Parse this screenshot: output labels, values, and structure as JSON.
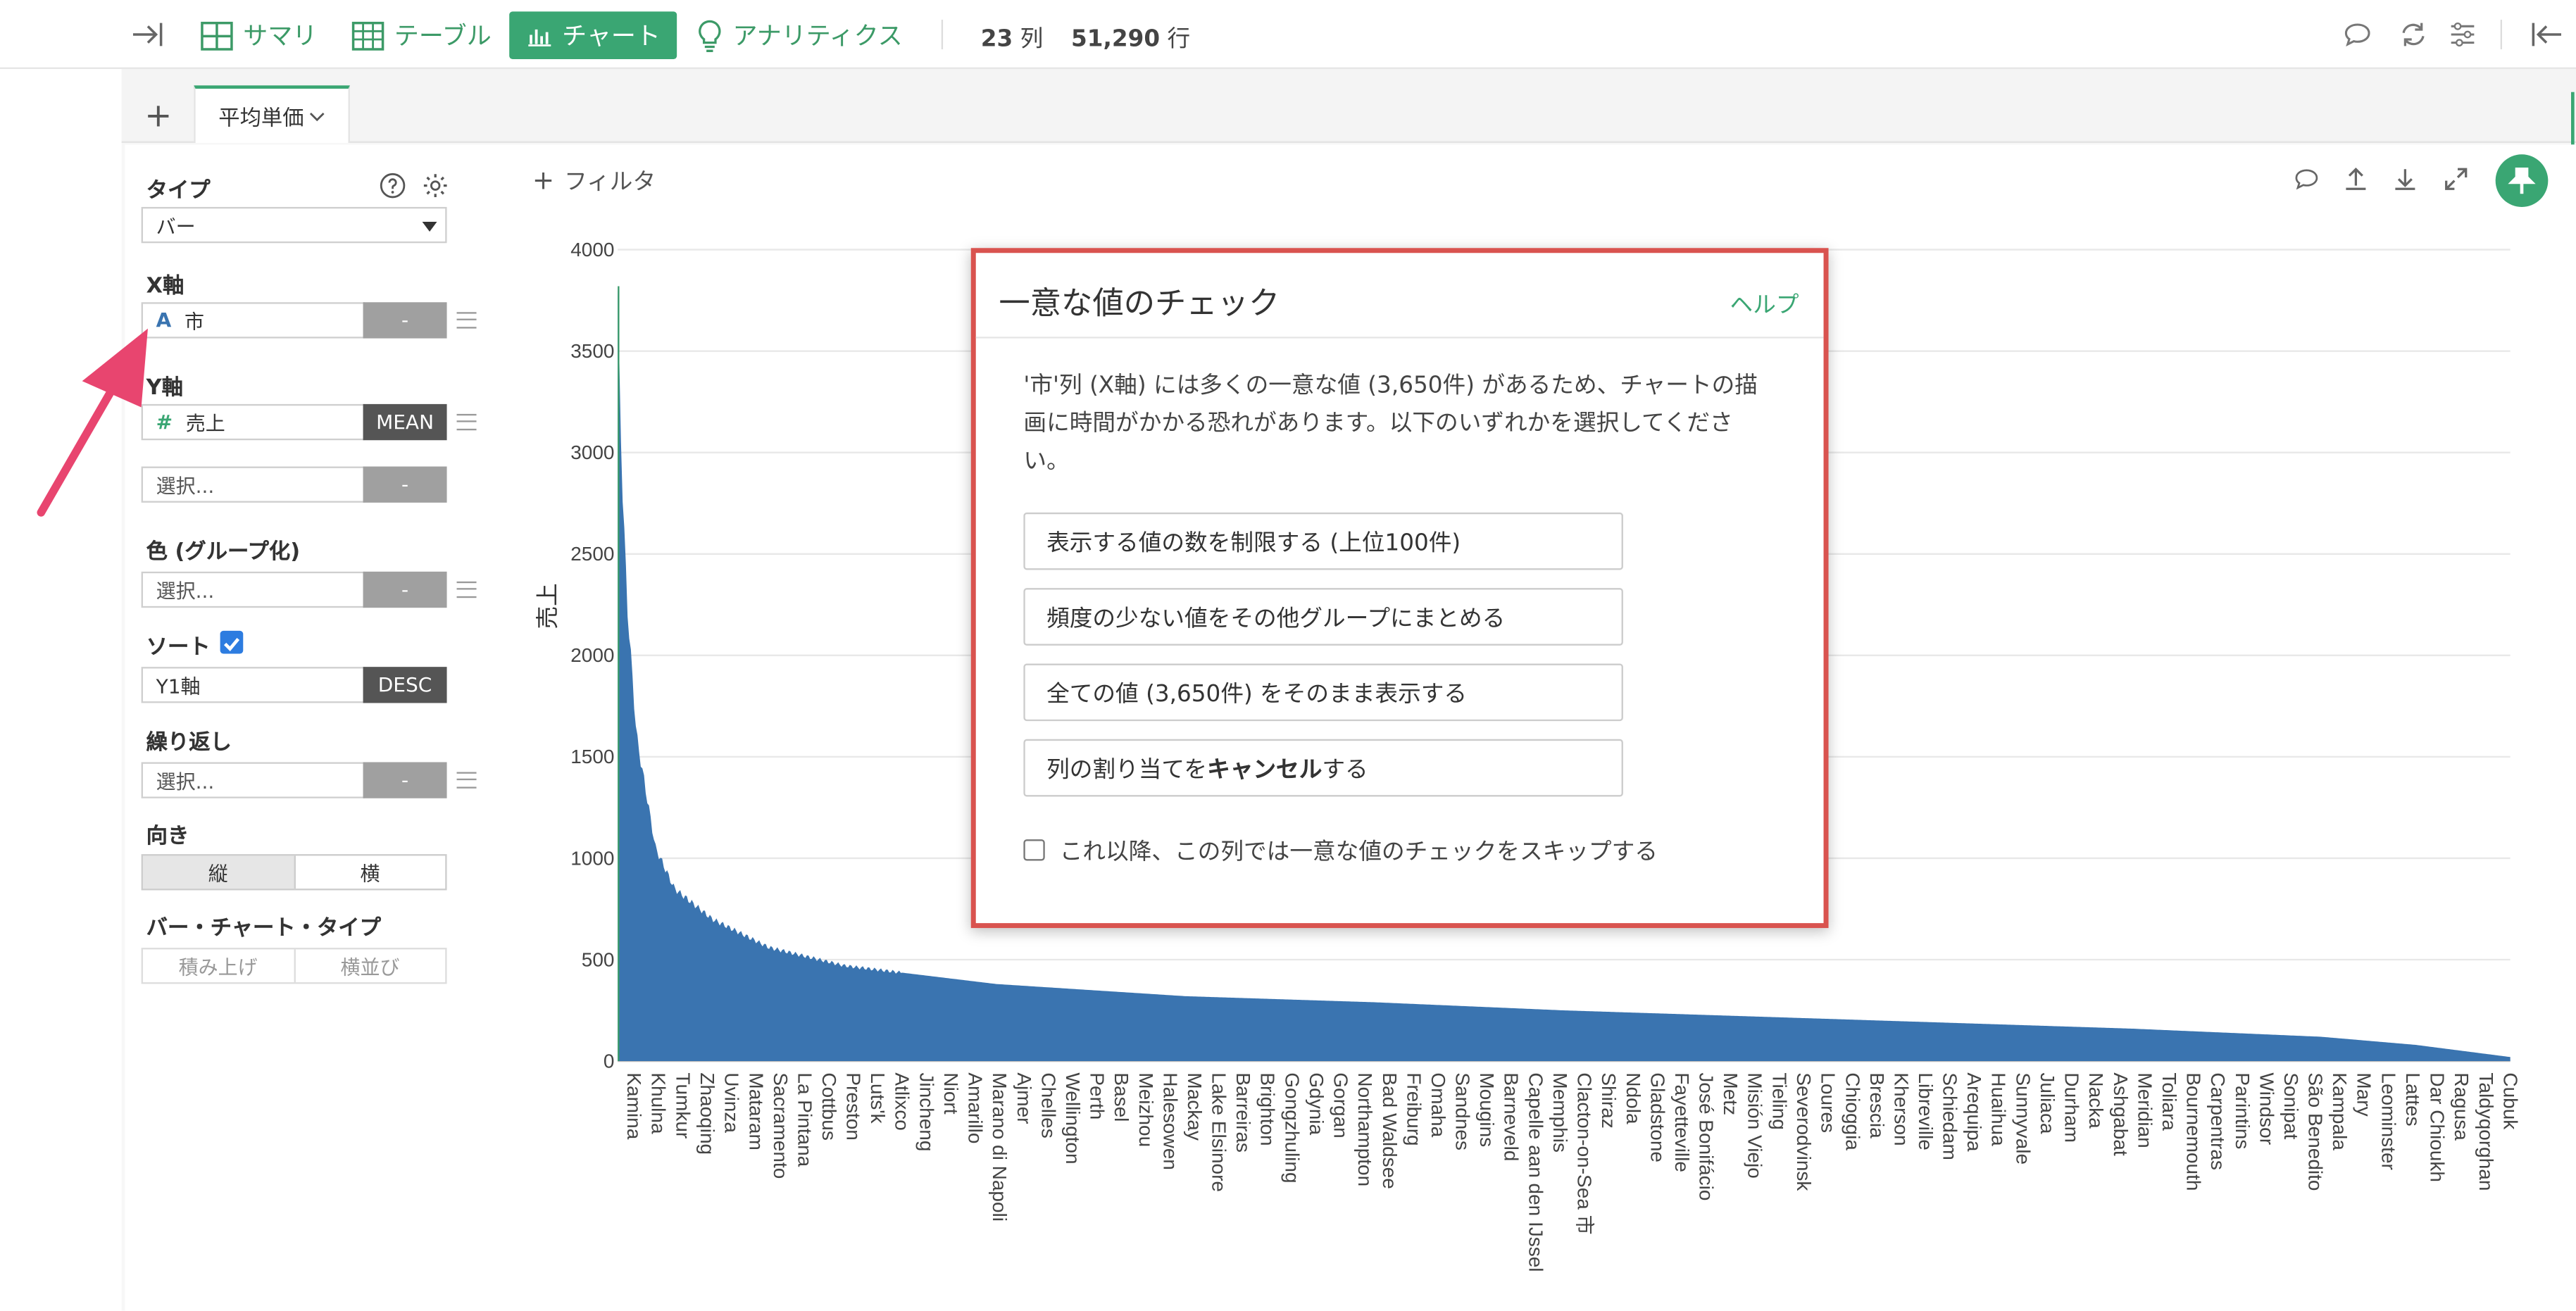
{
  "toolbar": {
    "tabs": [
      {
        "label": "サマリ",
        "icon": "summary-grid-icon"
      },
      {
        "label": "テーブル",
        "icon": "table-grid-icon"
      },
      {
        "label": "チャート",
        "icon": "bar-chart-icon",
        "active": true
      },
      {
        "label": "アナリティクス",
        "icon": "lightbulb-icon"
      }
    ],
    "columns_count": "23",
    "columns_unit": "列",
    "rows_count": "51,290",
    "rows_unit": "行",
    "accent_color": "#3aa673"
  },
  "chart_tabs": {
    "add_label": "+",
    "active_tab": "平均単価"
  },
  "left_panel": {
    "type_label": "タイプ",
    "type_value": "バー",
    "x_axis_label": "X軸",
    "x_column": "市",
    "x_agg": "-",
    "y_axis_label": "Y軸",
    "y_column": "売上",
    "y_agg": "MEAN",
    "y2_placeholder": "選択...",
    "y2_agg": "-",
    "color_label": "色 (グループ化)",
    "color_placeholder": "選択...",
    "color_agg": "-",
    "sort_label": "ソート",
    "sort_checked": true,
    "sort_by": "Y1軸",
    "sort_dir": "DESC",
    "repeat_label": "繰り返し",
    "repeat_placeholder": "選択...",
    "repeat_agg": "-",
    "orientation_label": "向き",
    "orientation_options": [
      "縦",
      "横"
    ],
    "bar_type_label": "バー・チャート・タイプ",
    "bar_type_options": [
      "積み上げ",
      "横並び"
    ]
  },
  "chart_header": {
    "filter_label": "フィルタ"
  },
  "modal": {
    "title": "一意な値のチェック",
    "help_link": "ヘルプ",
    "message_line1": "'市'列 (X軸) には多くの一意な値 (3,650件) があるため、チャートの描",
    "message_line2": "画に時間がかかる恐れがあります。以下のいずれかを選択してくださ",
    "message_line3": "い。",
    "option1": "表示する値の数を制限する (上位100件)",
    "option2": "頻度の少ない値をその他グループにまとめる",
    "option3": "全ての値 (3,650件) をそのまま表示する",
    "option4_prefix": "列の割り当てを",
    "option4_bold": "キャンセル",
    "option4_suffix": "する",
    "skip_label": "これ以降、この列では一意な値のチェックをスキップする"
  },
  "chart_data": {
    "type": "bar",
    "ylabel": "売上",
    "ylim": [
      0,
      4000
    ],
    "yticks": [
      0,
      500,
      1000,
      1500,
      2000,
      2500,
      3000,
      3500,
      4000
    ],
    "bar_color": "#3a74b0",
    "grid": true,
    "sorted": "descending",
    "series_profile": {
      "x_rank_pct": [
        0,
        0.2,
        0.5,
        1,
        2,
        3,
        5,
        8,
        12,
        20,
        30,
        40,
        50,
        60,
        70,
        80,
        90,
        95,
        100
      ],
      "y_value": [
        3820,
        2950,
        2250,
        1600,
        1050,
        850,
        700,
        560,
        470,
        380,
        320,
        290,
        250,
        220,
        190,
        160,
        120,
        80,
        20
      ]
    },
    "x_tick_labels": [
      "Kamina",
      "Khulna",
      "Tumkur",
      "Zhaoqing",
      "Uvinza",
      "Mataram",
      "Sacramento",
      "La Pintana",
      "Cottbus",
      "Preston",
      "Luts'k",
      "Atlixco",
      "Jincheng",
      "Niort",
      "Amarillo",
      "Marano di Napoli",
      "Ajmer",
      "Chelles",
      "Wellington",
      "Perth",
      "Basel",
      "Meizhou",
      "Halesowen",
      "Mackay",
      "Lake Elsinore",
      "Barreiras",
      "Brighton",
      "Gongzhuling",
      "Gdynia",
      "Gorgan",
      "Northampton",
      "Bad Waldsee",
      "Freiburg",
      "Omaha",
      "Sandnes",
      "Mougins",
      "Barneveld",
      "Capelle aan den IJssel",
      "Memphis",
      "Clacton-on-Sea 市",
      "Shiraz",
      "Ndola",
      "Gladstone",
      "Fayetteville",
      "José Bonifácio",
      "Metz",
      "Misión Viejo",
      "Tieling",
      "Severodvinsk",
      "Loures",
      "Chioggia",
      "Brescia",
      "Kherson",
      "Libreville",
      "Schiedam",
      "Arequipa",
      "Huaihua",
      "Sunnyvale",
      "Juliaca",
      "Durham",
      "Nacka",
      "Ashgabat",
      "Meridian",
      "Toliara",
      "Bournemouth",
      "Carpentras",
      "Parintins",
      "Windsor",
      "Sonipat",
      "São Benedito",
      "Kampala",
      "Mary",
      "Leominster",
      "Lattes",
      "Dar Chioukh",
      "Ragusa",
      "Taldyqorghan",
      "Cubuk"
    ]
  }
}
